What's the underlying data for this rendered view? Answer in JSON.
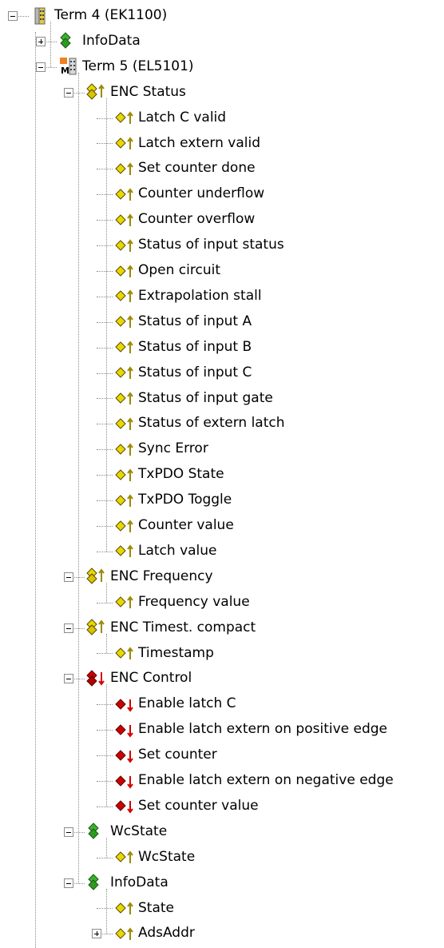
{
  "tree": {
    "rows": [
      {
        "label": "Term 4 (EK1100)",
        "level": 0,
        "icon": "coupler-icon",
        "exp": "minus"
      },
      {
        "label": "InfoData",
        "level": 1,
        "icon": "green-var-group-icon",
        "exp": "plus"
      },
      {
        "label": "Term 5 (EL5101)",
        "level": 1,
        "icon": "terminal-module-icon",
        "exp": "minus"
      },
      {
        "label": "ENC Status",
        "level": 2,
        "icon": "input-group-icon",
        "exp": "minus"
      },
      {
        "label": "Latch C valid",
        "level": 3,
        "icon": "input-var-icon"
      },
      {
        "label": "Latch extern valid",
        "level": 3,
        "icon": "input-var-icon"
      },
      {
        "label": "Set counter done",
        "level": 3,
        "icon": "input-var-icon"
      },
      {
        "label": "Counter underflow",
        "level": 3,
        "icon": "input-var-icon"
      },
      {
        "label": "Counter overflow",
        "level": 3,
        "icon": "input-var-icon"
      },
      {
        "label": "Status of input status",
        "level": 3,
        "icon": "input-var-icon"
      },
      {
        "label": "Open circuit",
        "level": 3,
        "icon": "input-var-icon"
      },
      {
        "label": "Extrapolation stall",
        "level": 3,
        "icon": "input-var-icon"
      },
      {
        "label": "Status of input A",
        "level": 3,
        "icon": "input-var-icon"
      },
      {
        "label": "Status of input B",
        "level": 3,
        "icon": "input-var-icon"
      },
      {
        "label": "Status of input C",
        "level": 3,
        "icon": "input-var-icon"
      },
      {
        "label": "Status of input gate",
        "level": 3,
        "icon": "input-var-icon"
      },
      {
        "label": "Status of extern latch",
        "level": 3,
        "icon": "input-var-icon"
      },
      {
        "label": "Sync Error",
        "level": 3,
        "icon": "input-var-icon"
      },
      {
        "label": "TxPDO State",
        "level": 3,
        "icon": "input-var-icon"
      },
      {
        "label": "TxPDO Toggle",
        "level": 3,
        "icon": "input-var-icon"
      },
      {
        "label": "Counter value",
        "level": 3,
        "icon": "input-var-icon"
      },
      {
        "label": "Latch value",
        "level": 3,
        "icon": "input-var-icon"
      },
      {
        "label": "ENC Frequency",
        "level": 2,
        "icon": "input-group-icon",
        "exp": "minus"
      },
      {
        "label": "Frequency value",
        "level": 3,
        "icon": "input-var-icon"
      },
      {
        "label": "ENC Timest. compact",
        "level": 2,
        "icon": "input-group-icon",
        "exp": "minus"
      },
      {
        "label": "Timestamp",
        "level": 3,
        "icon": "input-var-icon"
      },
      {
        "label": "ENC Control",
        "level": 2,
        "icon": "output-group-icon",
        "exp": "minus"
      },
      {
        "label": "Enable latch C",
        "level": 3,
        "icon": "output-var-icon"
      },
      {
        "label": "Enable latch extern on positive edge",
        "level": 3,
        "icon": "output-var-icon"
      },
      {
        "label": "Set counter",
        "level": 3,
        "icon": "output-var-icon"
      },
      {
        "label": "Enable latch extern on negative edge",
        "level": 3,
        "icon": "output-var-icon"
      },
      {
        "label": "Set counter value",
        "level": 3,
        "icon": "output-var-icon"
      },
      {
        "label": "WcState",
        "level": 2,
        "icon": "green-var-group-icon",
        "exp": "minus"
      },
      {
        "label": "WcState",
        "level": 3,
        "icon": "input-var-icon"
      },
      {
        "label": "InfoData",
        "level": 2,
        "icon": "green-var-group-icon",
        "exp": "minus"
      },
      {
        "label": "State",
        "level": 3,
        "icon": "input-var-icon"
      },
      {
        "label": "AdsAddr",
        "level": 3,
        "icon": "input-var-icon",
        "exp": "plus"
      }
    ]
  }
}
